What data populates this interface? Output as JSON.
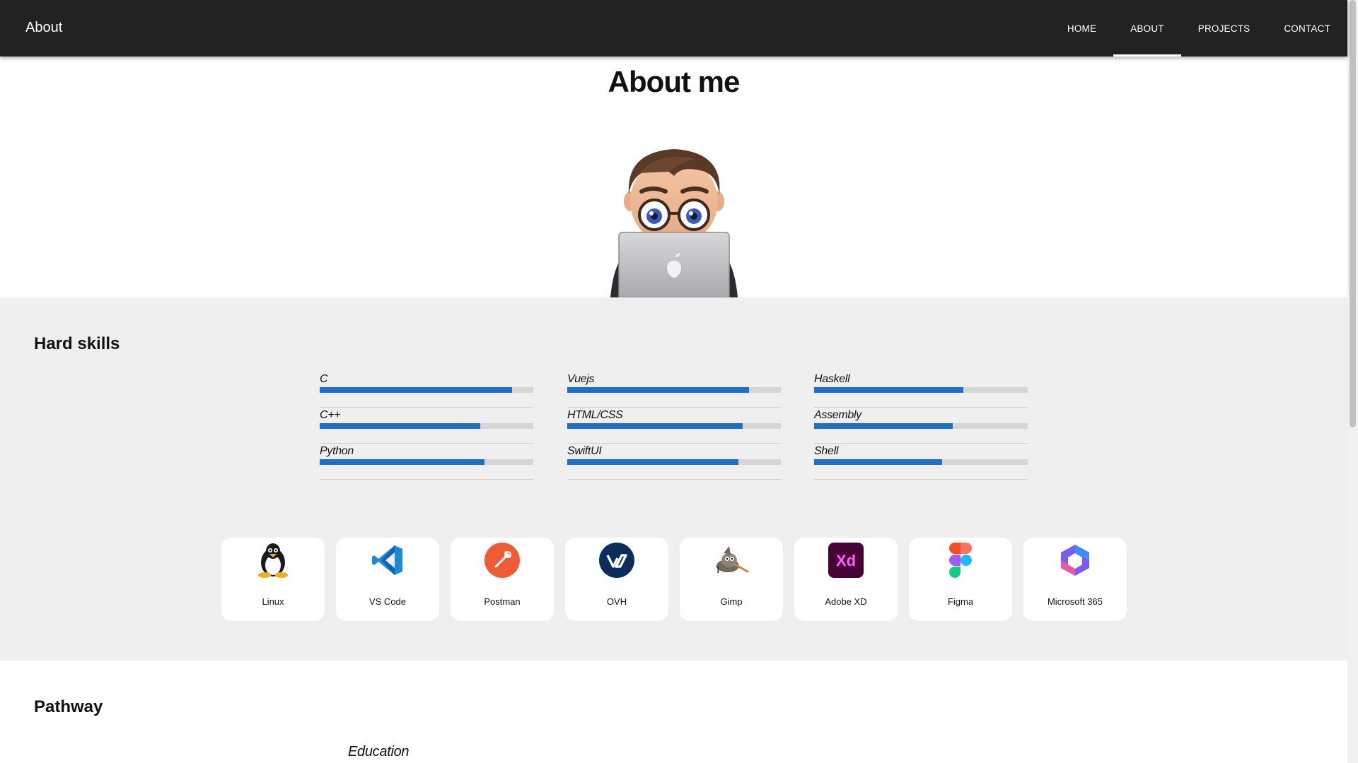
{
  "header": {
    "brand": "About",
    "nav": [
      {
        "label": "HOME",
        "active": false
      },
      {
        "label": "ABOUT",
        "active": true
      },
      {
        "label": "PROJECTS",
        "active": false
      },
      {
        "label": "CONTACT",
        "active": false
      }
    ]
  },
  "hero": {
    "title": "About me"
  },
  "skills": {
    "title": "Hard skills",
    "columns": [
      [
        {
          "name": "C",
          "level": 0.9
        },
        {
          "name": "C++",
          "level": 0.75
        },
        {
          "name": "Python",
          "level": 0.77
        }
      ],
      [
        {
          "name": "Vuejs",
          "level": 0.85
        },
        {
          "name": "HTML/CSS",
          "level": 0.82
        },
        {
          "name": "SwiftUI",
          "level": 0.8
        }
      ],
      [
        {
          "name": "Haskell",
          "level": 0.7
        },
        {
          "name": "Assembly",
          "level": 0.65
        },
        {
          "name": "Shell",
          "level": 0.6
        }
      ]
    ],
    "tools": [
      {
        "label": "Linux",
        "icon": "linux-tux-icon"
      },
      {
        "label": "VS Code",
        "icon": "vscode-icon"
      },
      {
        "label": "Postman",
        "icon": "postman-icon"
      },
      {
        "label": "OVH",
        "icon": "ovh-icon"
      },
      {
        "label": "Gimp",
        "icon": "gimp-icon"
      },
      {
        "label": "Adobe XD",
        "icon": "adobe-xd-icon"
      },
      {
        "label": "Figma",
        "icon": "figma-icon"
      },
      {
        "label": "Microsoft 365",
        "icon": "microsoft-365-icon"
      }
    ]
  },
  "pathway": {
    "title": "Pathway",
    "subtitle": "Education"
  },
  "colors": {
    "header_bg": "#222222",
    "skills_bg": "#efefef",
    "bar_fill": "#1d6fc9",
    "bar_track": "#d6d6d6"
  }
}
